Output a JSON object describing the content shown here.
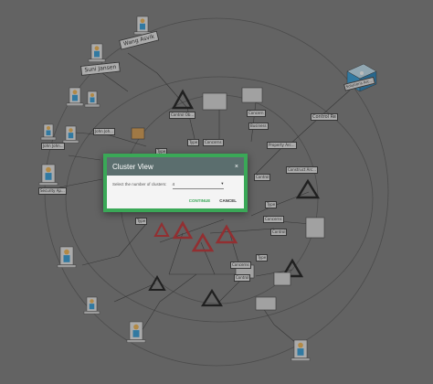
{
  "dialog": {
    "title": "Cluster View",
    "close_glyph": "×",
    "prompt": "Select the number of clusters:",
    "selected_value": "4",
    "dropdown_glyph": "▾",
    "continue_label": "CONTINUE",
    "cancel_label": "CANCEL"
  },
  "graph": {
    "labels": {
      "wang_asvik": "Wang Asvik",
      "suni_jansen": "Suni Jansen",
      "john_john_1": "John Joh...",
      "john_john_2": "John John...",
      "security_ap": "Security Ap...",
      "solutions_arc": "Solutions Arc...",
      "control_re": "Control Re",
      "type_1": "Type",
      "concerns_1": "Concerns",
      "type_2": "Type",
      "concerns_2": "Concerns",
      "type_3": "Type",
      "type_4": "Type",
      "concerns_3": "Concerns",
      "control_1": "Control",
      "control_2": "Control",
      "control_3": "Control",
      "business": "Business",
      "concern": "Concern",
      "property": "Property Arc...",
      "construct": "Construct Arc...",
      "control_ob": "Control Ob...",
      "type_5": "Type"
    },
    "colors": {
      "ring": "#545454",
      "edge": "#333333",
      "warning": "#c0282c",
      "person_body": "#2b9ad8",
      "person_face": "#f1b24a"
    }
  }
}
